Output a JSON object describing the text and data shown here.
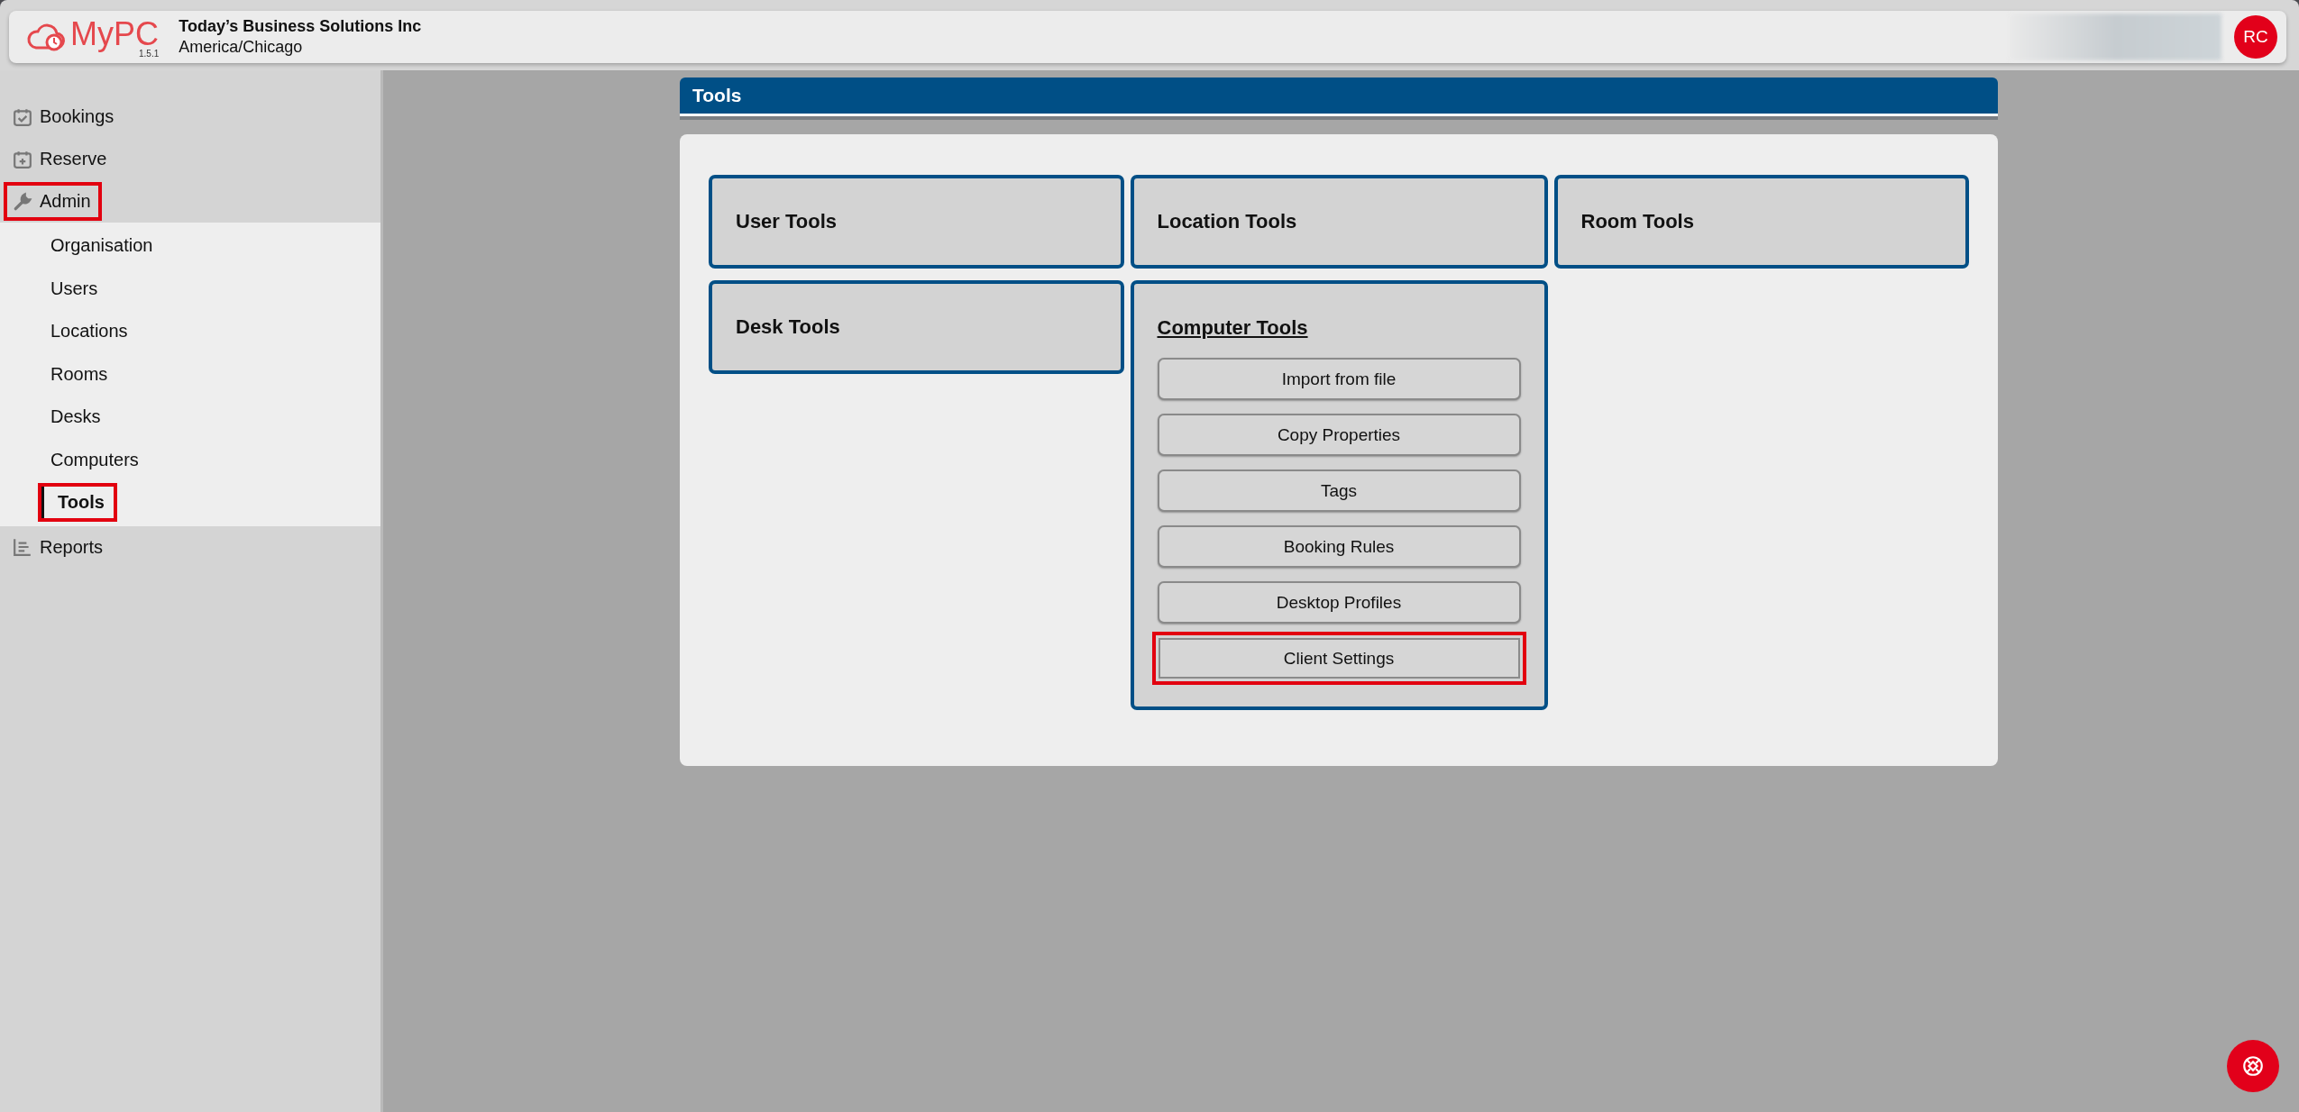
{
  "header": {
    "logo": "MyPC",
    "version": "1.5.1",
    "organisation": "Today’s Business Solutions Inc",
    "timezone": "America/Chicago",
    "avatar": "RC"
  },
  "sidebar": {
    "items": [
      {
        "label": "Bookings",
        "highlighted": false
      },
      {
        "label": "Reserve",
        "highlighted": false
      },
      {
        "label": "Admin",
        "highlighted": true,
        "children": [
          {
            "label": "Organisation",
            "selected": false,
            "highlighted": false
          },
          {
            "label": "Users",
            "selected": false,
            "highlighted": false
          },
          {
            "label": "Locations",
            "selected": false,
            "highlighted": false
          },
          {
            "label": "Rooms",
            "selected": false,
            "highlighted": false
          },
          {
            "label": "Desks",
            "selected": false,
            "highlighted": false
          },
          {
            "label": "Computers",
            "selected": false,
            "highlighted": false
          },
          {
            "label": "Tools",
            "selected": true,
            "highlighted": true
          }
        ]
      },
      {
        "label": "Reports",
        "highlighted": false
      }
    ]
  },
  "panel": {
    "title": "Tools",
    "tiles": [
      {
        "title": "User Tools",
        "expanded": false
      },
      {
        "title": "Location Tools",
        "expanded": false
      },
      {
        "title": "Room Tools",
        "expanded": false
      },
      {
        "title": "Desk Tools",
        "expanded": false
      },
      {
        "title": "Computer Tools",
        "expanded": true,
        "buttons": [
          {
            "label": "Import from file",
            "highlighted": false
          },
          {
            "label": "Copy Properties",
            "highlighted": false
          },
          {
            "label": "Tags",
            "highlighted": false
          },
          {
            "label": "Booking Rules",
            "highlighted": false
          },
          {
            "label": "Desktop Profiles",
            "highlighted": false
          },
          {
            "label": "Client Settings",
            "highlighted": true
          }
        ]
      }
    ]
  }
}
